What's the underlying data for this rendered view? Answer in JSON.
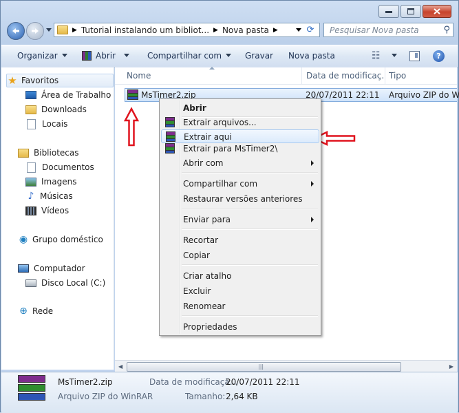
{
  "address": {
    "breadcrumbs": [
      "Tutorial instalando um bibliot...",
      "Nova pasta"
    ]
  },
  "search": {
    "placeholder": "Pesquisar Nova pasta"
  },
  "toolbar": {
    "organize": "Organizar",
    "open": "Abrir",
    "share": "Compartilhar com",
    "burn": "Gravar",
    "new_folder": "Nova pasta"
  },
  "nav": {
    "favorites": "Favoritos",
    "desktop": "Área de Trabalho",
    "downloads": "Downloads",
    "places": "Locais",
    "libraries": "Bibliotecas",
    "documents": "Documentos",
    "images": "Imagens",
    "music": "Músicas",
    "videos": "Vídeos",
    "homegroup": "Grupo doméstico",
    "computer": "Computador",
    "local_disk": "Disco Local (C:)",
    "network": "Rede"
  },
  "columns": {
    "name": "Nome",
    "date": "Data de modificaç...",
    "type": "Tipo"
  },
  "file": {
    "name": "MsTimer2.zip",
    "date": "20/07/2011 22:11",
    "type": "Arquivo ZIP do Wi"
  },
  "context_menu": {
    "open": "Abrir",
    "extract_files": "Extrair arquivos...",
    "extract_here": "Extrair aqui",
    "extract_to": "Extrair para MsTimer2\\",
    "open_with": "Abrir com",
    "share_with": "Compartilhar com",
    "restore": "Restaurar versões anteriores",
    "send_to": "Enviar para",
    "cut": "Recortar",
    "copy": "Copiar",
    "create_shortcut": "Criar atalho",
    "delete": "Excluir",
    "rename": "Renomear",
    "properties": "Propriedades"
  },
  "details": {
    "name": "MsTimer2.zip",
    "type": "Arquivo ZIP do WinRAR",
    "date_label": "Data de modificaçã...",
    "date_value": "20/07/2011 22:11",
    "size_label": "Tamanho:",
    "size_value": "2,64 KB"
  },
  "colors": {
    "annotation_red": "#e0141e",
    "selection": "#cfe3fa",
    "accent": "#2b58b6"
  }
}
